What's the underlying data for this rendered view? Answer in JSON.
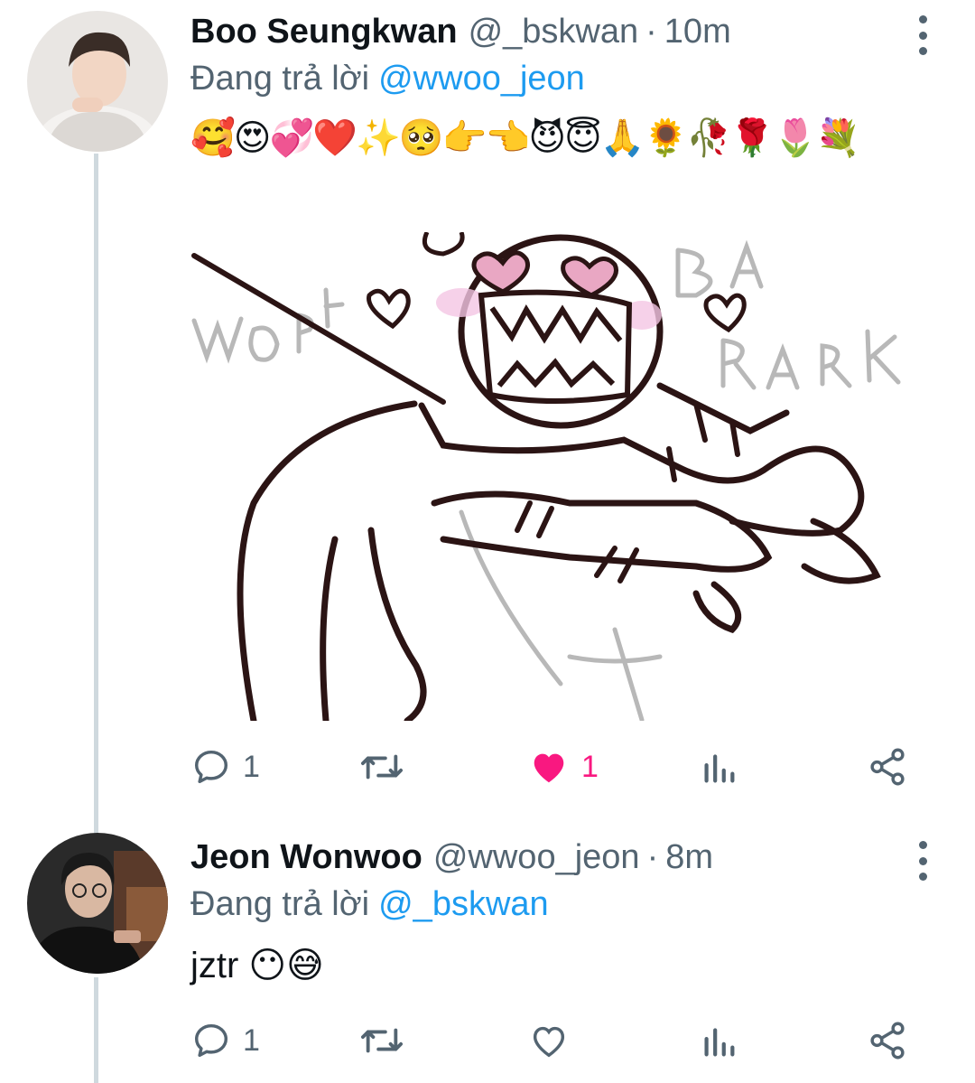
{
  "tweets": [
    {
      "display_name": "Boo Seungkwan",
      "handle": "@_bskwan",
      "separator": "·",
      "time": "10m",
      "replying_prefix": "Đang trả lời",
      "replying_to": "@wwoo_jeon",
      "text": "🥰😍💞❤️✨🥺👉👈😈😇🙏🌻🥀🌹🌷💐",
      "has_media": true,
      "media_words": [
        "WOOF",
        "BARK",
        "BARK"
      ],
      "actions": {
        "reply_count": "1",
        "retweet_count": "",
        "like_count": "1",
        "liked": true
      }
    },
    {
      "display_name": "Jeon Wonwoo",
      "handle": "@wwoo_jeon",
      "separator": "·",
      "time": "8m",
      "replying_prefix": "Đang trả lời",
      "replying_to": "@_bskwan",
      "text": "jztr 😶😅",
      "has_media": false,
      "actions": {
        "reply_count": "1",
        "retweet_count": "",
        "like_count": "",
        "liked": false
      }
    }
  ],
  "colors": {
    "link": "#1d9bf0",
    "muted": "#536471",
    "like_active": "#f91880",
    "thread_line": "#cfd9de"
  },
  "icons": [
    "reply-icon",
    "retweet-icon",
    "like-icon",
    "analytics-icon",
    "share-icon",
    "more-icon"
  ]
}
